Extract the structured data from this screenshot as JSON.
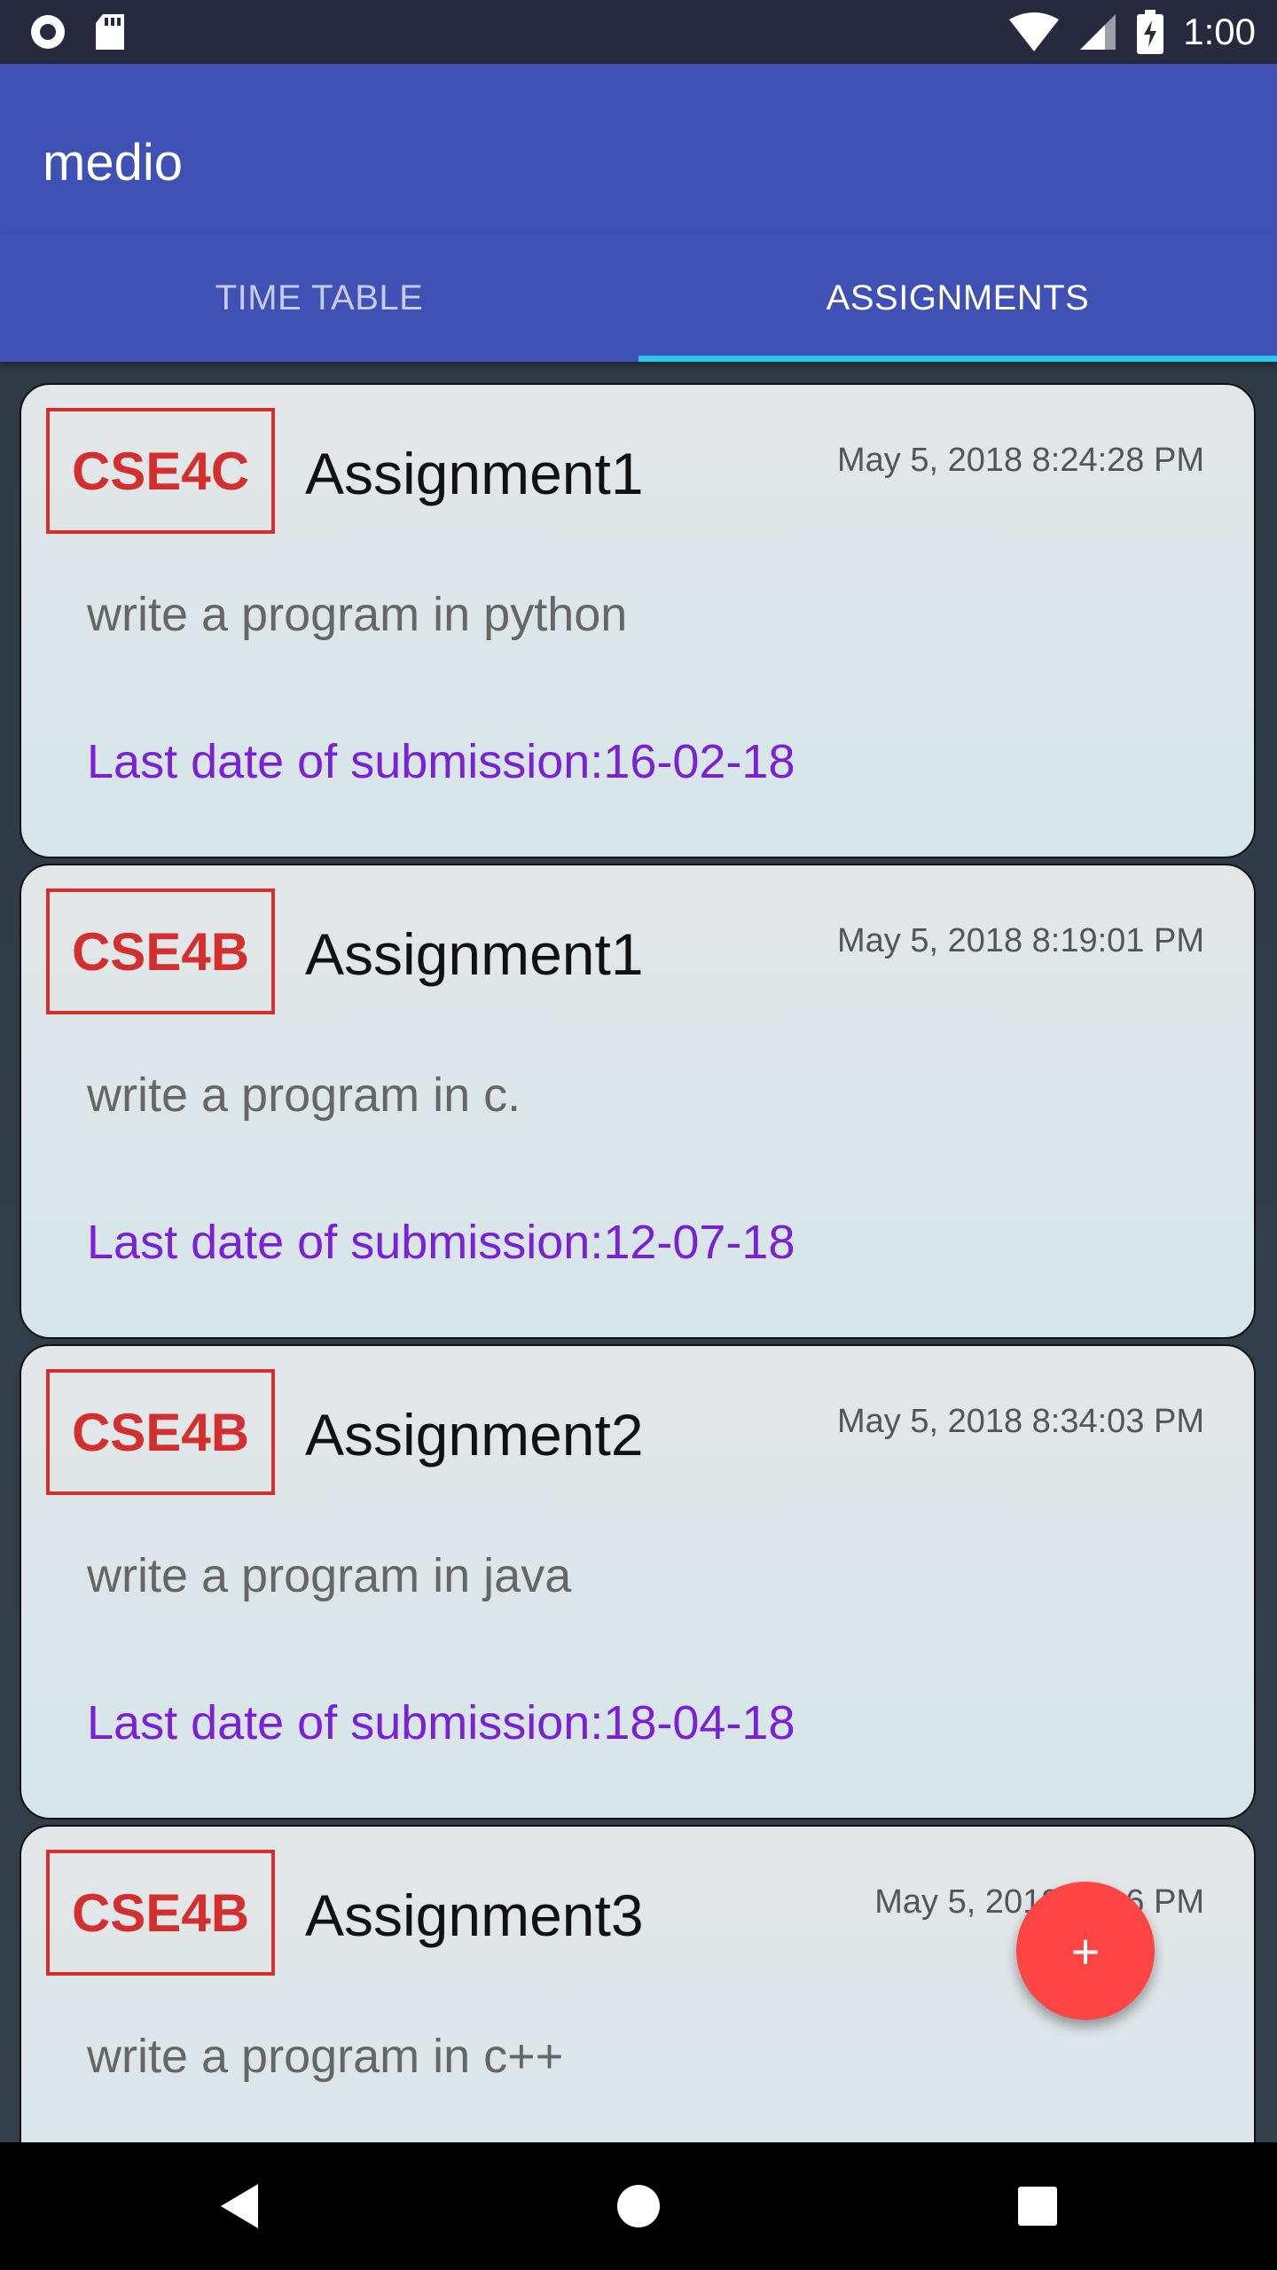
{
  "status_bar": {
    "time": "1:00",
    "icons": [
      "circle-status-icon",
      "sd-card-icon",
      "wifi-icon",
      "signal-icon",
      "battery-charging-icon"
    ]
  },
  "app_bar": {
    "title": "medio"
  },
  "tabs": [
    {
      "label": "TIME TABLE",
      "active": false
    },
    {
      "label": "ASSIGNMENTS",
      "active": true
    }
  ],
  "assignments": [
    {
      "class_code": "CSE4C",
      "title": "Assignment1",
      "created": "May 5, 2018 8:24:28 PM",
      "description": "write a program in python",
      "due": "Last date of submission:16-02-18"
    },
    {
      "class_code": "CSE4B",
      "title": "Assignment1",
      "created": "May 5, 2018 8:19:01 PM",
      "description": "write a program in c.",
      "due": "Last date of submission:12-07-18"
    },
    {
      "class_code": "CSE4B",
      "title": "Assignment2",
      "created": "May 5, 2018 8:34:03 PM",
      "description": "write a program in java",
      "due": "Last date of submission:18-04-18"
    },
    {
      "class_code": "CSE4B",
      "title": "Assignment3",
      "created": "May 5, 2018 8:  :  6 PM",
      "description": "write a program in c++",
      "due": ""
    }
  ],
  "fab": {
    "label": "+",
    "icon": "add-icon"
  },
  "colors": {
    "primary": "#3f51b5",
    "tab_indicator": "#29c5ea",
    "badge_red": "#d32f2f",
    "due_purple": "#7b1fd8",
    "fab_red": "#ff4444"
  },
  "nav_bar": {
    "icons": [
      "back-icon",
      "home-icon",
      "recents-icon"
    ]
  }
}
